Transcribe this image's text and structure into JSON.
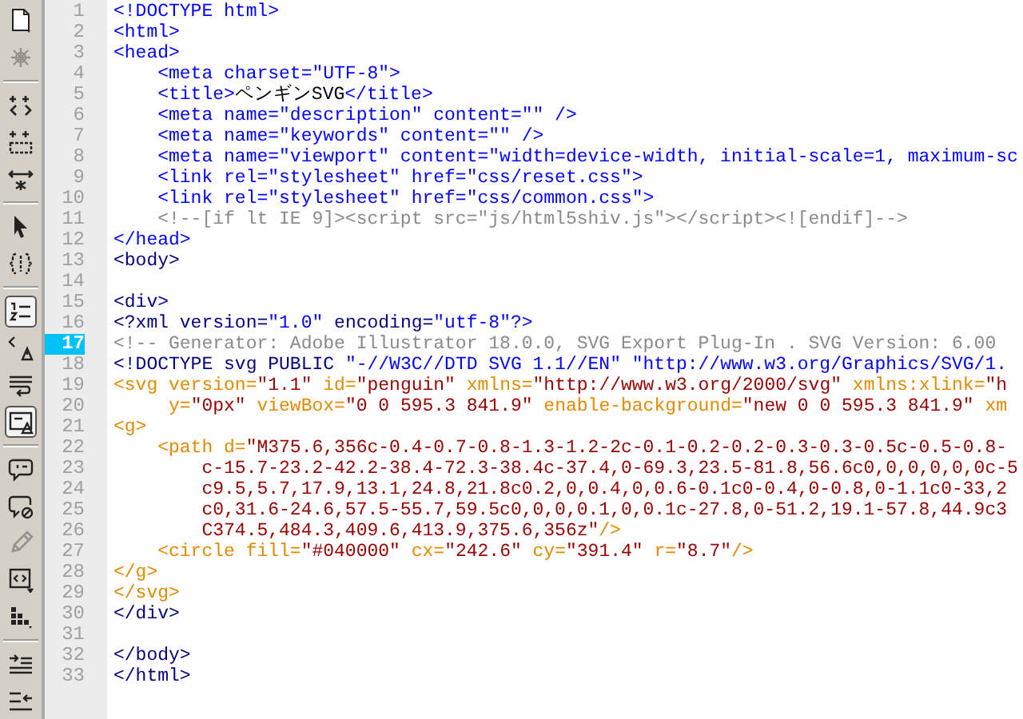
{
  "toolbar": {
    "groups": [
      [
        {
          "kind": "document",
          "disabled": false,
          "on": false
        },
        {
          "kind": "asterisk",
          "disabled": true,
          "on": false
        }
      ],
      [
        {
          "kind": "chevrons",
          "disabled": false,
          "on": false
        },
        {
          "kind": "dashed-box",
          "disabled": false,
          "on": false
        },
        {
          "kind": "double-arrow",
          "disabled": false,
          "on": false
        }
      ],
      [
        {
          "kind": "cursor",
          "disabled": false,
          "on": false
        },
        {
          "kind": "braces",
          "disabled": false,
          "on": false
        }
      ],
      [
        {
          "kind": "numbered-list",
          "disabled": false,
          "on": true
        },
        {
          "kind": "warning",
          "disabled": false,
          "on": false
        },
        {
          "kind": "wrap",
          "disabled": false,
          "on": false
        },
        {
          "kind": "warning-panel",
          "disabled": false,
          "on": true
        }
      ],
      [
        {
          "kind": "speech-bubble",
          "disabled": false,
          "on": false
        },
        {
          "kind": "bubble-blocked",
          "disabled": false,
          "on": false
        },
        {
          "kind": "pencil",
          "disabled": true,
          "on": false
        },
        {
          "kind": "code-tag",
          "disabled": false,
          "on": false
        },
        {
          "kind": "grid",
          "disabled": false,
          "on": false
        }
      ],
      [
        {
          "kind": "indent",
          "disabled": false,
          "on": false
        },
        {
          "kind": "outdent",
          "disabled": false,
          "on": false
        }
      ]
    ]
  },
  "editor": {
    "lines": [
      {
        "number": "1",
        "selected": false,
        "tokens": [
          {
            "kind": "tag",
            "text": "<!DOCTYPE html>"
          }
        ]
      },
      {
        "number": "2",
        "selected": false,
        "tokens": [
          {
            "kind": "tag",
            "text": "<html>"
          }
        ]
      },
      {
        "number": "3",
        "selected": false,
        "tokens": [
          {
            "kind": "tag",
            "text": "<head>"
          }
        ]
      },
      {
        "number": "4",
        "selected": false,
        "tokens": [
          {
            "kind": "tag",
            "text": "    <meta charset=\"UTF-8\">"
          }
        ]
      },
      {
        "number": "5",
        "selected": false,
        "tokens": [
          {
            "kind": "tag",
            "text": "    <title>"
          },
          {
            "kind": "plain",
            "text": "ペンギンSVG"
          },
          {
            "kind": "tag",
            "text": "</title>"
          }
        ]
      },
      {
        "number": "6",
        "selected": false,
        "tokens": [
          {
            "kind": "tag",
            "text": "    <meta name=\"description\" content=\"\" />"
          }
        ]
      },
      {
        "number": "7",
        "selected": false,
        "tokens": [
          {
            "kind": "tag",
            "text": "    <meta name=\"keywords\" content=\"\" />"
          }
        ]
      },
      {
        "number": "8",
        "selected": false,
        "tokens": [
          {
            "kind": "tag",
            "text": "    <meta name=\"viewport\" content=\"width=device-width, initial-scale=1, maximum-sc"
          }
        ]
      },
      {
        "number": "9",
        "selected": false,
        "tokens": [
          {
            "kind": "tag",
            "text": "    <link rel=\"stylesheet\" href=\"css/reset.css\">"
          }
        ]
      },
      {
        "number": "10",
        "selected": false,
        "tokens": [
          {
            "kind": "tag",
            "text": "    <link rel=\"stylesheet\" href=\"css/common.css\">"
          }
        ]
      },
      {
        "number": "11",
        "selected": false,
        "tokens": [
          {
            "kind": "comment",
            "text": "    <!--[if lt IE 9]><script src=\"js/html5shiv.js\"></script><![endif]-->"
          }
        ]
      },
      {
        "number": "12",
        "selected": false,
        "tokens": [
          {
            "kind": "tag",
            "text": "</head>"
          }
        ]
      },
      {
        "number": "13",
        "selected": false,
        "tokens": [
          {
            "kind": "block",
            "text": "<body>"
          }
        ]
      },
      {
        "number": "14",
        "selected": false
      },
      {
        "number": "15",
        "selected": false,
        "tokens": [
          {
            "kind": "block",
            "text": "<div>"
          }
        ]
      },
      {
        "number": "16",
        "selected": false,
        "tokens": [
          {
            "kind": "block",
            "text": "<?xml version="
          },
          {
            "kind": "tag",
            "text": "\"1.0\""
          },
          {
            "kind": "block",
            "text": " encoding="
          },
          {
            "kind": "tag",
            "text": "\"utf-8\"?>"
          }
        ]
      },
      {
        "number": "17",
        "selected": true,
        "tokens": [
          {
            "kind": "comment",
            "text": "<!-- Generator: Adobe Illustrator 18.0.0, SVG Export Plug-In . SVG Version: 6.00"
          }
        ]
      },
      {
        "number": "18",
        "selected": false,
        "tokens": [
          {
            "kind": "block",
            "text": "<!DOCTYPE svg PUBLIC "
          },
          {
            "kind": "tag",
            "text": "\"-//W3C//DTD SVG 1.1//EN\" \"http://www.w3.org/Graphics/SVG/1."
          }
        ]
      },
      {
        "number": "19",
        "selected": false,
        "tokens": [
          {
            "kind": "svgtag",
            "text": "<svg version="
          },
          {
            "kind": "svgval",
            "text": "\"1.1\""
          },
          {
            "kind": "svgtag",
            "text": " id="
          },
          {
            "kind": "svgval",
            "text": "\"penguin\""
          },
          {
            "kind": "svgtag",
            "text": " xmlns="
          },
          {
            "kind": "svgval",
            "text": "\"http://www.w3.org/2000/svg\""
          },
          {
            "kind": "svgtag",
            "text": " xmlns:xlink="
          },
          {
            "kind": "svgval",
            "text": "\"h"
          }
        ]
      },
      {
        "number": "20",
        "selected": false,
        "tokens": [
          {
            "kind": "svgtag",
            "text": "     y="
          },
          {
            "kind": "svgval",
            "text": "\"0px\""
          },
          {
            "kind": "svgtag",
            "text": " viewBox="
          },
          {
            "kind": "svgval",
            "text": "\"0 0 595.3 841.9\""
          },
          {
            "kind": "svgtag",
            "text": " enable-background="
          },
          {
            "kind": "svgval",
            "text": "\"new 0 0 595.3 841.9\""
          },
          {
            "kind": "svgtag",
            "text": " xm"
          }
        ]
      },
      {
        "number": "21",
        "selected": false,
        "tokens": [
          {
            "kind": "svgtag",
            "text": "<g>"
          }
        ]
      },
      {
        "number": "22",
        "selected": false,
        "tokens": [
          {
            "kind": "svgtag",
            "text": "    <path d="
          },
          {
            "kind": "svgval",
            "text": "\"M375.6,356c-0.4-0.7-0.8-1.3-1.2-2c-0.1-0.2-0.2-0.3-0.3-0.5c-0.5-0.8-"
          }
        ]
      },
      {
        "number": "23",
        "selected": false,
        "tokens": [
          {
            "kind": "svgval",
            "text": "        c-15.7-23.2-42.2-38.4-72.3-38.4c-37.4,0-69.3,23.5-81.8,56.6c0,0,0,0,0,0c-5"
          }
        ]
      },
      {
        "number": "24",
        "selected": false,
        "tokens": [
          {
            "kind": "svgval",
            "text": "        c9.5,5.7,17.9,13.1,24.8,21.8c0.2,0,0.4,0,0.6-0.1c0-0.4,0-0.8,0-1.1c0-33,2"
          }
        ]
      },
      {
        "number": "25",
        "selected": false,
        "tokens": [
          {
            "kind": "svgval",
            "text": "        c0,31.6-24.6,57.5-55.7,59.5c0,0,0,0.1,0,0.1c-27.8,0-51.2,19.1-57.8,44.9c3"
          }
        ]
      },
      {
        "number": "26",
        "selected": false,
        "tokens": [
          {
            "kind": "svgval",
            "text": "        C374.5,484.3,409.6,413.9,375.6,356z\""
          },
          {
            "kind": "svgtag",
            "text": "/>"
          }
        ]
      },
      {
        "number": "27",
        "selected": false,
        "tokens": [
          {
            "kind": "svgtag",
            "text": "    <circle fill="
          },
          {
            "kind": "svgval",
            "text": "\"#040000\""
          },
          {
            "kind": "svgtag",
            "text": " cx="
          },
          {
            "kind": "svgval",
            "text": "\"242.6\""
          },
          {
            "kind": "svgtag",
            "text": " cy="
          },
          {
            "kind": "svgval",
            "text": "\"391.4\""
          },
          {
            "kind": "svgtag",
            "text": " r="
          },
          {
            "kind": "svgval",
            "text": "\"8.7\""
          },
          {
            "kind": "svgtag",
            "text": "/>"
          }
        ]
      },
      {
        "number": "28",
        "selected": false,
        "tokens": [
          {
            "kind": "svgtag",
            "text": "</g>"
          }
        ]
      },
      {
        "number": "29",
        "selected": false,
        "tokens": [
          {
            "kind": "svgtag",
            "text": "</svg>"
          }
        ]
      },
      {
        "number": "30",
        "selected": false,
        "tokens": [
          {
            "kind": "block",
            "text": "</div>"
          }
        ]
      },
      {
        "number": "31",
        "selected": false
      },
      {
        "number": "32",
        "selected": false,
        "tokens": [
          {
            "kind": "block",
            "text": "</body>"
          }
        ]
      },
      {
        "number": "33",
        "selected": false,
        "tokens": [
          {
            "kind": "block",
            "text": "</html>"
          }
        ]
      }
    ]
  }
}
